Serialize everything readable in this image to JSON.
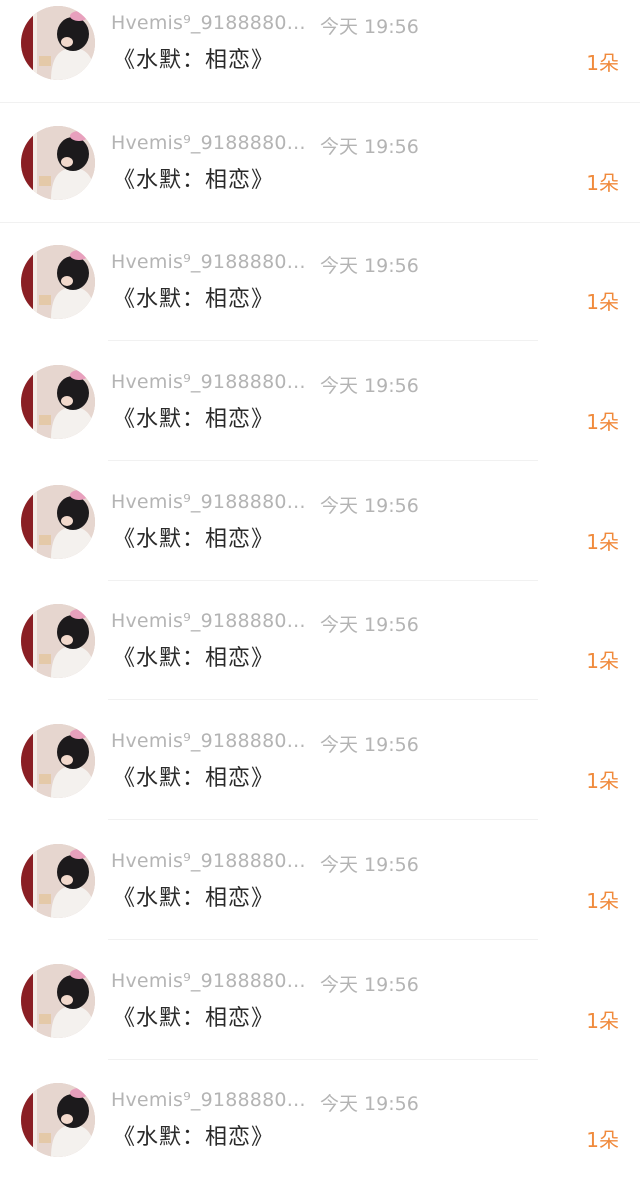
{
  "messages": [
    {
      "sender": "Hvemis⁹_9188880…",
      "time": "今天 19:56",
      "gift": "《水默：相恋》",
      "count": "1朵",
      "avatar_icon": "user-avatar-photo"
    },
    {
      "sender": "Hvemis⁹_9188880…",
      "time": "今天 19:56",
      "gift": "《水默：相恋》",
      "count": "1朵",
      "avatar_icon": "user-avatar-photo"
    },
    {
      "sender": "Hvemis⁹_9188880…",
      "time": "今天 19:56",
      "gift": "《水默：相恋》",
      "count": "1朵",
      "avatar_icon": "user-avatar-photo"
    },
    {
      "sender": "Hvemis⁹_9188880…",
      "time": "今天 19:56",
      "gift": "《水默：相恋》",
      "count": "1朵",
      "avatar_icon": "user-avatar-photo"
    },
    {
      "sender": "Hvemis⁹_9188880…",
      "time": "今天 19:56",
      "gift": "《水默：相恋》",
      "count": "1朵",
      "avatar_icon": "user-avatar-photo"
    },
    {
      "sender": "Hvemis⁹_9188880…",
      "time": "今天 19:56",
      "gift": "《水默：相恋》",
      "count": "1朵",
      "avatar_icon": "user-avatar-photo"
    },
    {
      "sender": "Hvemis⁹_9188880…",
      "time": "今天 19:56",
      "gift": "《水默：相恋》",
      "count": "1朵",
      "avatar_icon": "user-avatar-photo"
    },
    {
      "sender": "Hvemis⁹_9188880…",
      "time": "今天 19:56",
      "gift": "《水默：相恋》",
      "count": "1朵",
      "avatar_icon": "user-avatar-photo"
    },
    {
      "sender": "Hvemis⁹_9188880…",
      "time": "今天 19:56",
      "gift": "《水默：相恋》",
      "count": "1朵",
      "avatar_icon": "user-avatar-photo"
    },
    {
      "sender": "Hvemis⁹_9188880…",
      "time": "今天 19:56",
      "gift": "《水默：相恋》",
      "count": "1朵",
      "avatar_icon": "user-avatar-photo"
    }
  ],
  "colors": {
    "sender_text": "#b4b4b4",
    "gift_text": "#2a2a2a",
    "count_accent": "#f08a3c",
    "divider": "#f1f1f1"
  }
}
